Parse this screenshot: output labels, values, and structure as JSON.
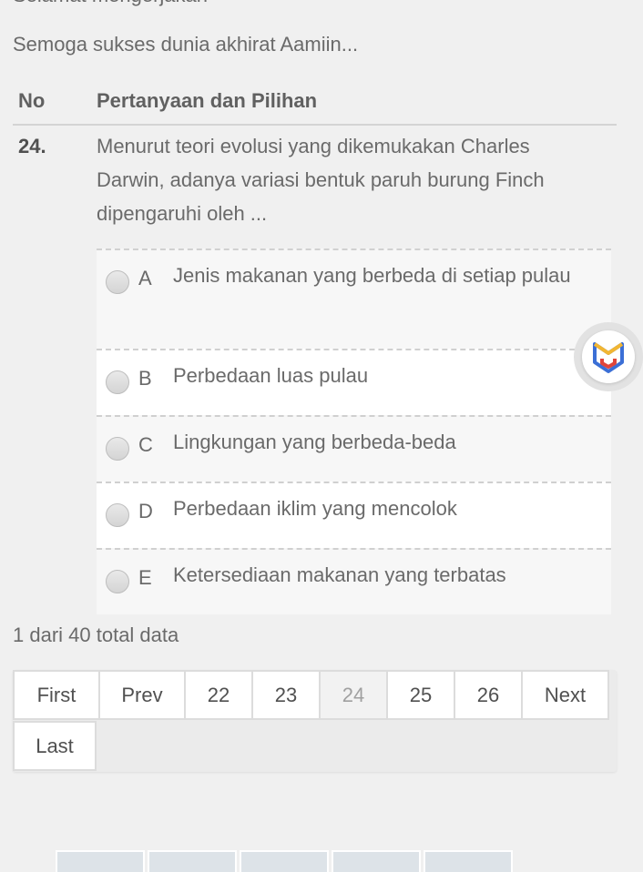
{
  "header": {
    "top_cut_text": "Selamat mengerjakan",
    "greeting": "Semoga sukses dunia akhirat Aamiin..."
  },
  "table": {
    "col_no": "No",
    "col_question": "Pertanyaan dan Pilihan"
  },
  "question": {
    "number": "24.",
    "text": "Menurut teori evolusi yang dikemukakan Charles Darwin, adanya variasi bentuk paruh burung Finch dipengaruhi oleh ...",
    "options": [
      {
        "letter": "A",
        "text": "Jenis makanan yang berbeda di setiap pulau"
      },
      {
        "letter": "B",
        "text": "Perbedaan luas pulau"
      },
      {
        "letter": "C",
        "text": "Lingkungan yang berbeda-beda"
      },
      {
        "letter": "D",
        "text": "Perbedaan iklim yang mencolok"
      },
      {
        "letter": "E",
        "text": "Ketersediaan makanan yang terbatas"
      }
    ]
  },
  "summary": "1 dari 40 total data",
  "pagination": {
    "first": "First",
    "prev": "Prev",
    "pages": [
      "22",
      "23",
      "24",
      "25",
      "26"
    ],
    "current": "24",
    "next": "Next",
    "last": "Last"
  },
  "fab_icon": "app-logo-icon",
  "colors": {
    "logo_blue": "#3b6fd6",
    "logo_yellow": "#f2b632",
    "logo_red": "#e0453a"
  }
}
